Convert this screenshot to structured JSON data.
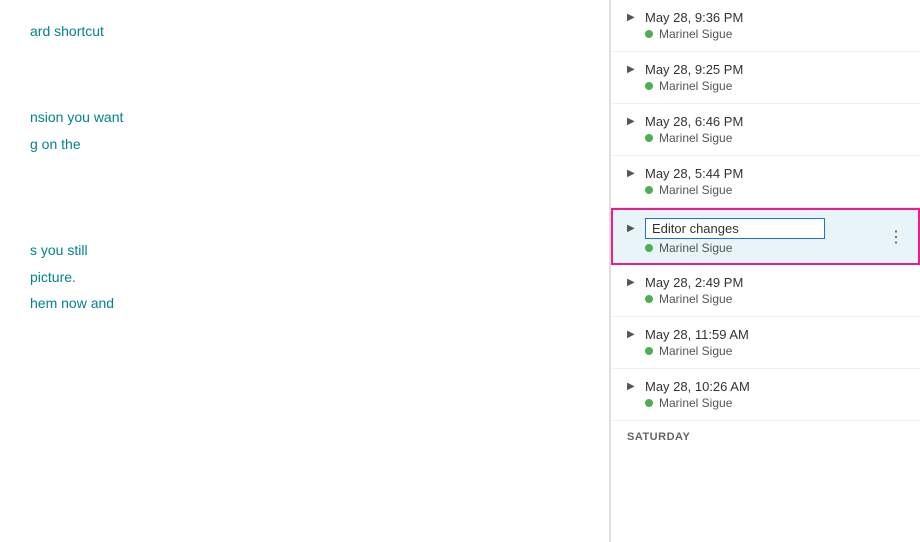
{
  "left_panel": {
    "lines": [
      {
        "id": 1,
        "text": "ard shortcut"
      },
      {
        "id": 2,
        "text": "nsion you want"
      },
      {
        "id": 3,
        "text": "g on the"
      },
      {
        "id": 4,
        "text": "s you still"
      },
      {
        "id": 5,
        "text": "picture."
      },
      {
        "id": 6,
        "text": "hem now and"
      }
    ]
  },
  "sidebar": {
    "versions": [
      {
        "id": "v1",
        "time": "May 28, 9:36 PM",
        "author": "Marinel Sigue",
        "editing": false,
        "active": false
      },
      {
        "id": "v2",
        "time": "May 28, 9:25 PM",
        "author": "Marinel Sigue",
        "editing": false,
        "active": false
      },
      {
        "id": "v3",
        "time": "May 28, 6:46 PM",
        "author": "Marinel Sigue",
        "editing": false,
        "active": false
      },
      {
        "id": "v4",
        "time": "May 28, 5:44 PM",
        "author": "Marinel Sigue",
        "editing": false,
        "active": false
      },
      {
        "id": "v5",
        "time": "Editor changes",
        "author": "Marinel Sigue",
        "editing": true,
        "active": true
      },
      {
        "id": "v6",
        "time": "May 28, 2:49 PM",
        "author": "Marinel Sigue",
        "editing": false,
        "active": false
      },
      {
        "id": "v7",
        "time": "May 28, 11:59 AM",
        "author": "Marinel Sigue",
        "editing": false,
        "active": false
      },
      {
        "id": "v8",
        "time": "May 28, 10:26 AM",
        "author": "Marinel Sigue",
        "editing": false,
        "active": false
      }
    ],
    "section_label": "SATURDAY"
  },
  "icons": {
    "chevron": "▶",
    "more": "⋮"
  }
}
